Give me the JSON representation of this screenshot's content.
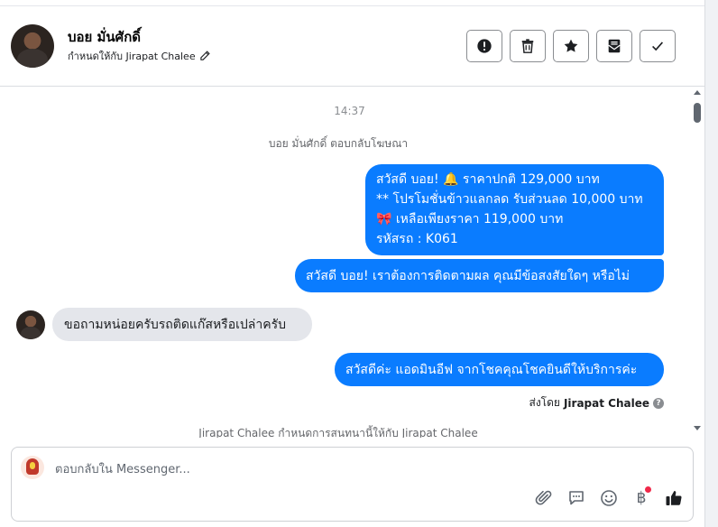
{
  "header": {
    "contact_name": "บอย มั่นศักดิ์",
    "assigned_text": "กำหนดให้กับ Jirapat Chalee",
    "actions": [
      {
        "name": "mark-spam-button",
        "icon": "exclamation-circle-icon"
      },
      {
        "name": "delete-button",
        "icon": "trash-icon"
      },
      {
        "name": "star-button",
        "icon": "star-icon"
      },
      {
        "name": "mark-unread-button",
        "icon": "envelope-icon"
      },
      {
        "name": "mark-done-button",
        "icon": "check-icon"
      }
    ]
  },
  "chat": {
    "timestamp": "14:37",
    "system_reply_ad": "บอย มั่นศักดิ์ ตอบกลับโฆษณา",
    "outgoing_1_lines": [
      "สวัสดี บอย! 🔔 ราคาปกติ 129,000 บาท",
      "** โปรโมชั่นข้าวแลกลด รับส่วนลด 10,000 บาท",
      "🎀  เหลือเพียงราคา 119,000 บาท",
      " รหัสรถ : K061"
    ],
    "outgoing_2": "สวัสดี บอย! เราต้องการติดตามผล คุณมีข้อสงสัยใดๆ หรือไม่",
    "incoming_1": "ขอถามหน่อยครับรถติดแก๊สหรือเปล่าครับ",
    "outgoing_3": "สวัสดีค่ะ แอดมินอีฟ จากโชคคุณโชคยินดีให้บริการค่ะ",
    "sent_by_prefix": "ส่งโดย",
    "sent_by_name": "Jirapat Chalee",
    "system_assigned": "Jirapat Chalee กำหนดการสนทนานี้ให้กับ Jirapat Chalee"
  },
  "composer": {
    "placeholder": "ตอบกลับใน Messenger...",
    "tools": [
      "attach-icon",
      "saved-replies-icon",
      "emoji-icon",
      "baht-payment-icon",
      "like-icon"
    ],
    "baht_symbol": "฿"
  },
  "colors": {
    "outgoing_bubble": "#0a7cff",
    "incoming_bubble": "#e4e6eb",
    "notification_dot": "#f02849"
  }
}
